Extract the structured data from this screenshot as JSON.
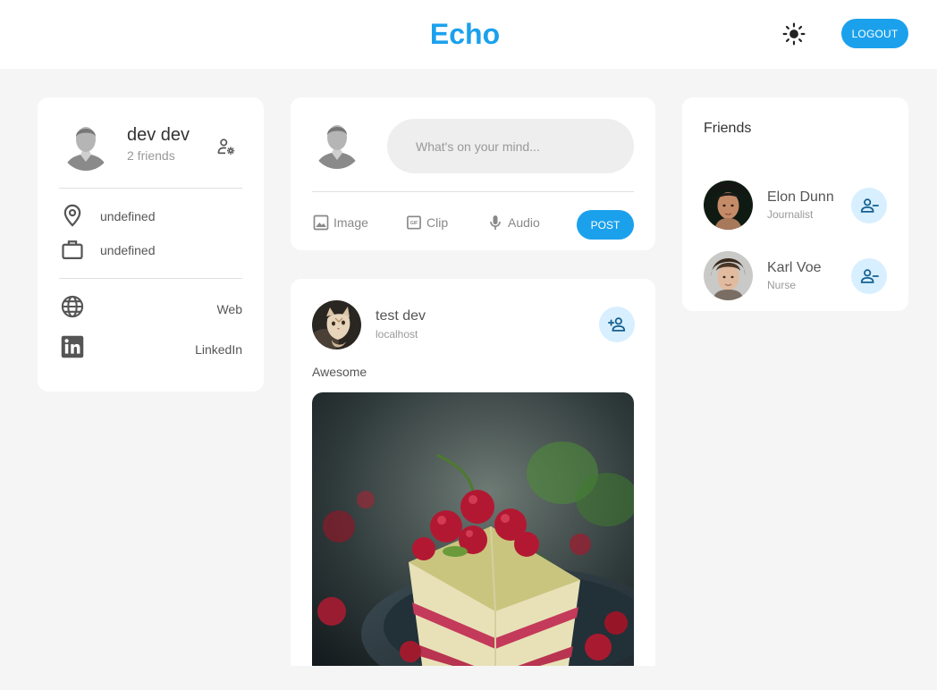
{
  "header": {
    "brand": "Echo",
    "logout_label": "LOGOUT",
    "theme_icon": "sun-icon"
  },
  "profile": {
    "name": "dev dev",
    "friends_count": "2 friends",
    "location": "undefined",
    "occupation": "undefined",
    "social": [
      {
        "label": "Web",
        "icon": "globe-icon"
      },
      {
        "label": "LinkedIn",
        "icon": "linkedin-icon"
      }
    ]
  },
  "composer": {
    "placeholder": "What's on your mind...",
    "attachments": [
      {
        "label": "Image",
        "icon": "image-icon"
      },
      {
        "label": "Clip",
        "icon": "gif-icon"
      },
      {
        "label": "Audio",
        "icon": "mic-icon"
      }
    ],
    "post_label": "POST"
  },
  "feed": {
    "post": {
      "author": "test dev",
      "location": "localhost",
      "description": "Awesome"
    }
  },
  "friends": {
    "title": "Friends",
    "list": [
      {
        "name": "Elon Dunn",
        "occupation": "Journalist"
      },
      {
        "name": "Karl Voe",
        "occupation": "Nurse"
      }
    ]
  },
  "colors": {
    "accent": "#1ba1ec",
    "accent_light": "#d7efff",
    "background": "#f5f5f5"
  }
}
